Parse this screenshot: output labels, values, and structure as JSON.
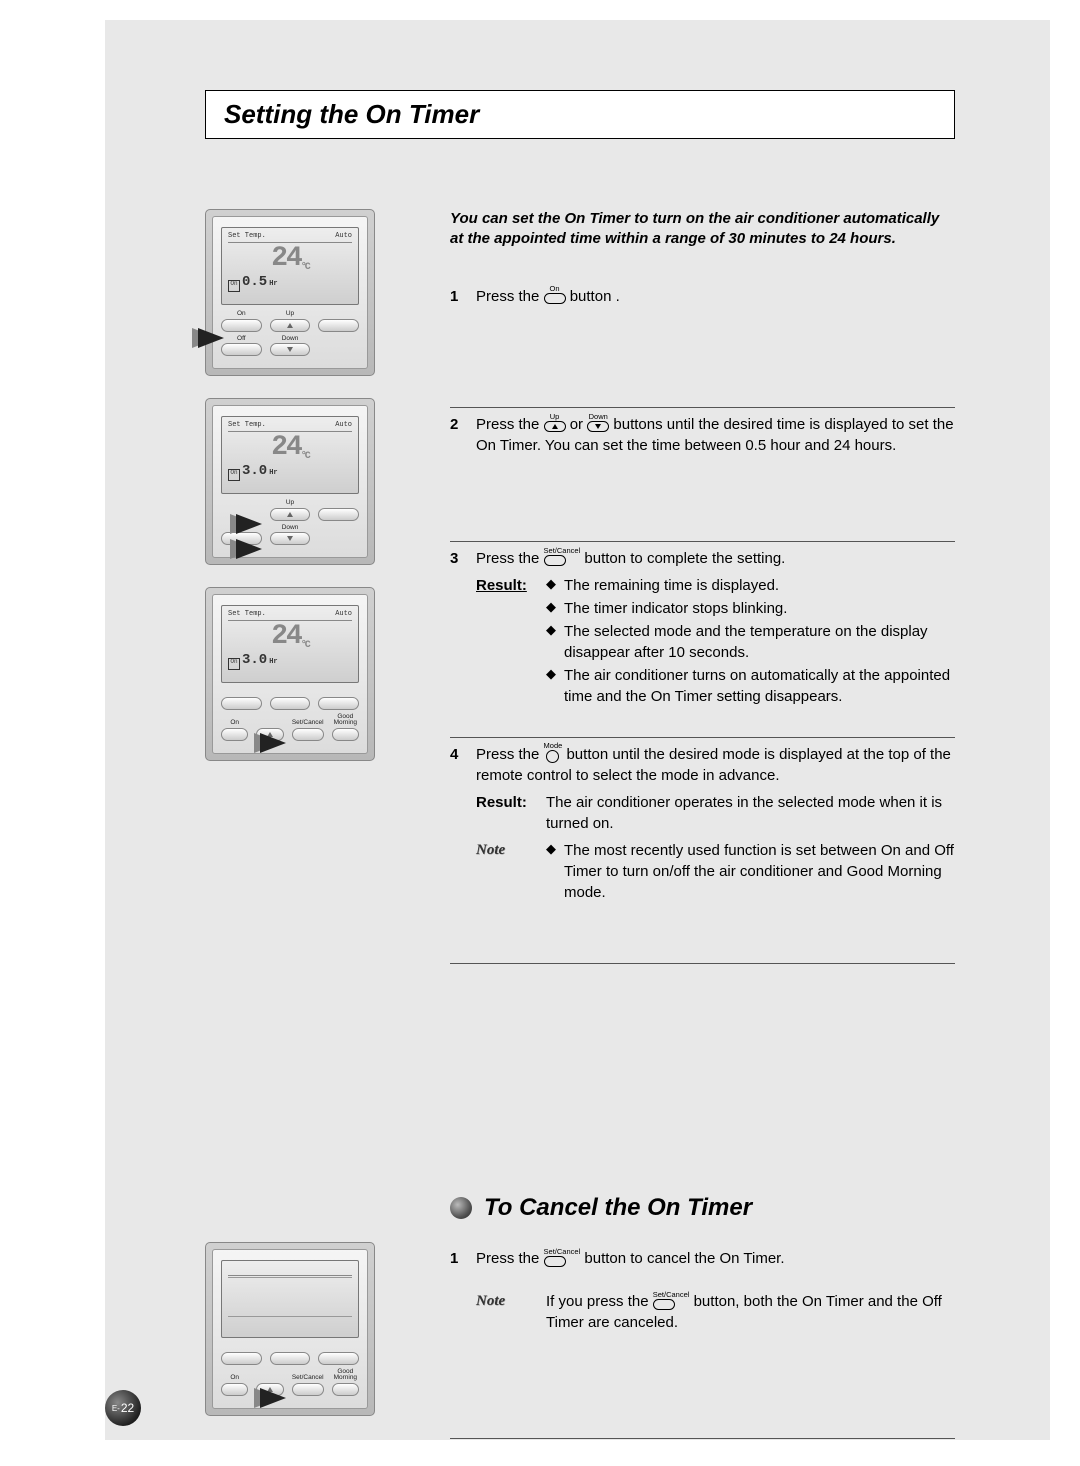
{
  "title": "Setting the On Timer",
  "intro": "You can set the On Timer to turn on the air conditioner automatically at the appointed time within a range of 30 minutes to 24 hours.",
  "buttons": {
    "on": "On",
    "off": "Off",
    "up": "Up",
    "down": "Down",
    "setcancel": "Set/Cancel",
    "mode": "Mode",
    "goodmorning": "Good Morning"
  },
  "steps": {
    "s1": {
      "num": "1",
      "pre": "Press the ",
      "post": " button ."
    },
    "s2": {
      "num": "2",
      "pre": "Press the ",
      "mid": " or ",
      "post": " buttons until the desired time is displayed to set the On Timer. You can set the time between 0.5 hour and 24 hours."
    },
    "s3": {
      "num": "3",
      "pre": "Press the ",
      "post": " button to complete the setting.",
      "result_label": "Result:",
      "bullets": [
        "The remaining time is displayed.",
        "The timer indicator stops blinking.",
        "The selected mode and the temperature on the display disappear after 10 seconds.",
        "The air conditioner turns on automatically at the appointed time and the On Timer setting disappears."
      ]
    },
    "s4": {
      "num": "4",
      "pre": "Press the ",
      "post": " button until the desired mode is displayed at the top of the remote control to select the mode in advance.",
      "result_label": "Result:",
      "result_text": "The air conditioner operates in the selected mode when it is turned on.",
      "note_label": "Note",
      "note_bullet": "The most recently used function is set between On and Off Timer to turn on/off the air conditioner and Good Morning mode."
    }
  },
  "cancel": {
    "heading": "To Cancel the On Timer",
    "s1": {
      "num": "1",
      "pre": "Press the ",
      "post": " button to cancel the On Timer."
    },
    "note_label": "Note",
    "note_pre": "If you press the ",
    "note_post": " button, both the On Timer and the Off Timer are canceled."
  },
  "remote": {
    "set_temp": "Set Temp.",
    "auto": "Auto",
    "temp": "24",
    "unit": "°C",
    "timer1": "0.5",
    "timer2": "3.0",
    "timer3": "3.0",
    "hr": "Hr",
    "on_label": "On",
    "off_label": "Off",
    "up_label": "Up",
    "down_label": "Down",
    "setcancel_label": "Set/Cancel",
    "goodmorning_label": "Good Morning"
  },
  "page_num_prefix": "E-",
  "page_num": "22"
}
